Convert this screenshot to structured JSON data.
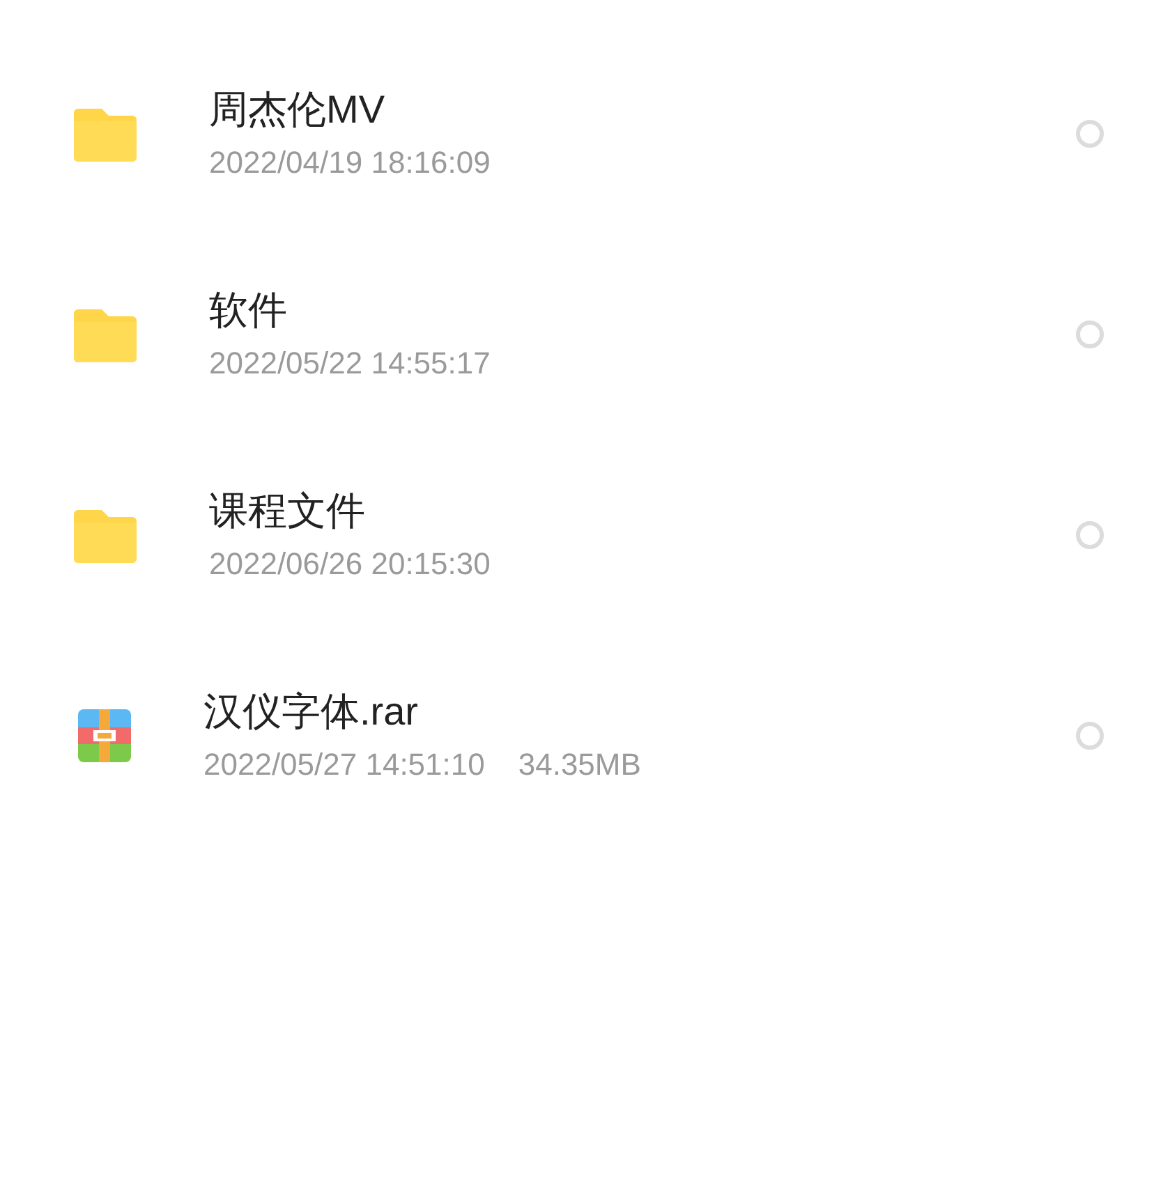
{
  "files": [
    {
      "kind": "folder",
      "name": "周杰伦MV",
      "date": "2022/04/19 18:16:09",
      "selected": false
    },
    {
      "kind": "folder",
      "name": "软件",
      "date": "2022/05/22 14:55:17",
      "selected": false
    },
    {
      "kind": "folder",
      "name": "课程文件",
      "date": "2022/06/26 20:15:30",
      "selected": false
    },
    {
      "kind": "archive",
      "name": "汉仪字体.rar",
      "date": "2022/05/27 14:51:10",
      "size": "34.35MB",
      "selected": false
    }
  ]
}
